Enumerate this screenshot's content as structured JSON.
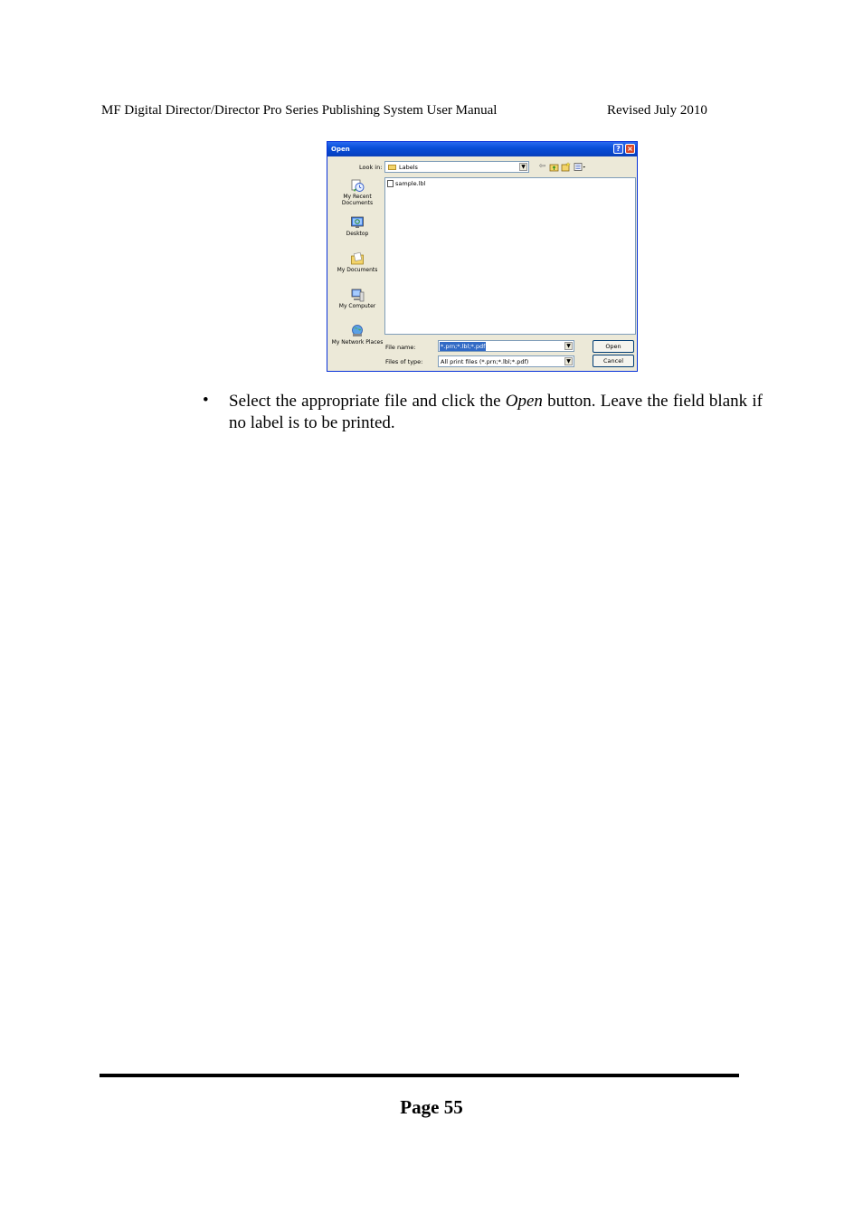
{
  "header": {
    "title": "MF Digital Director/Director Pro Series Publishing System User Manual",
    "revision": "Revised July 2010"
  },
  "dialog": {
    "title": "Open",
    "look_in_label": "Look in:",
    "look_in_value": "Labels",
    "places": [
      {
        "label": "My Recent Documents",
        "icon": "recent-documents-icon"
      },
      {
        "label": "Desktop",
        "icon": "desktop-icon"
      },
      {
        "label": "My Documents",
        "icon": "my-documents-icon"
      },
      {
        "label": "My Computer",
        "icon": "my-computer-icon"
      },
      {
        "label": "My Network Places",
        "icon": "network-places-icon"
      }
    ],
    "files": [
      "sample.lbl"
    ],
    "file_name_label": "File name:",
    "file_name_value": "*.prn;*.lbl;*.pdf",
    "file_type_label": "Files of type:",
    "file_type_value": "All print files (*.prn;*.lbl;*.pdf)",
    "open_label": "Open",
    "cancel_label": "Cancel"
  },
  "body": {
    "bullet": "•",
    "text_before": "Select the appropriate file and click the ",
    "text_italic": "Open",
    "text_after": " button. Leave the field blank if no label is to be printed."
  },
  "footer": {
    "page": "Page 55"
  }
}
